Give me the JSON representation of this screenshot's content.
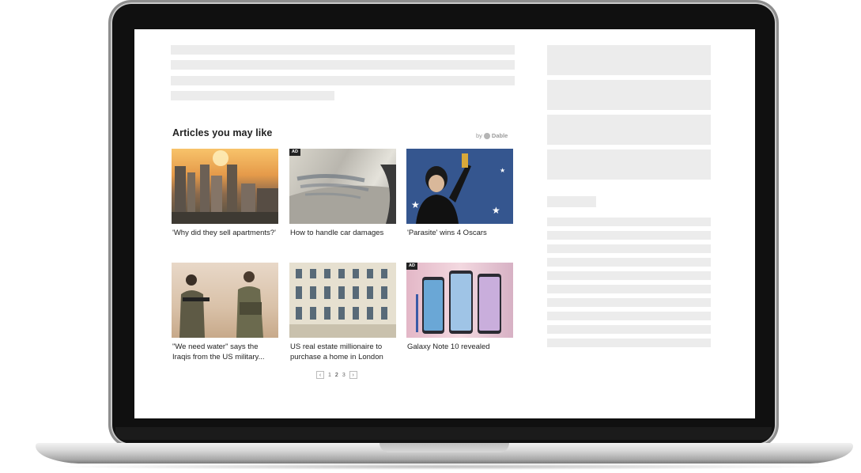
{
  "widget": {
    "title": "Articles you may like",
    "brand_prefix": "by",
    "brand_name": "Dable"
  },
  "articles": [
    {
      "caption": "'Why did they sell apartments?'",
      "ad": false,
      "icon": "city-skyline-photo"
    },
    {
      "caption": "How to handle car damages",
      "ad": true,
      "ad_label": "AD",
      "icon": "car-scratch-photo"
    },
    {
      "caption": "'Parasite' wins 4 Oscars",
      "ad": false,
      "icon": "oscar-winner-photo"
    },
    {
      "caption": "\"We need water\" says the Iraqis from the US military...",
      "ad": false,
      "icon": "soldiers-photo"
    },
    {
      "caption": "US real estate millionaire to purchase a home in London",
      "ad": false,
      "icon": "building-photo"
    },
    {
      "caption": "Galaxy Note 10 revealed",
      "ad": true,
      "ad_label": "AD",
      "icon": "smartphones-photo"
    }
  ],
  "pagination": {
    "prev": "‹",
    "pages": [
      "1",
      "2",
      "3"
    ],
    "next": "›"
  }
}
